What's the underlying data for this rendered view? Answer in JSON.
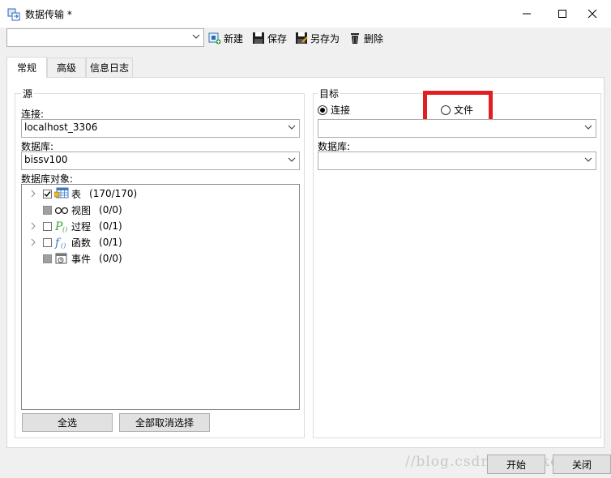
{
  "window": {
    "title": "数据传输 *"
  },
  "toolbar": {
    "profile_value": "",
    "new_label": "新建",
    "save_label": "保存",
    "save_as_label": "另存为",
    "delete_label": "删除"
  },
  "tabs": [
    {
      "label": "常规",
      "active": true
    },
    {
      "label": "高级",
      "active": false
    },
    {
      "label": "信息日志",
      "active": false
    }
  ],
  "source": {
    "group_label": "源",
    "connection_label": "连接:",
    "connection_value": "localhost_3306",
    "database_label": "数据库:",
    "database_value": "bissv100",
    "objects_label": "数据库对象:",
    "objects": [
      {
        "name": "表",
        "count": "(170/170)",
        "icon": "table-icon",
        "expandable": true,
        "check": "checked"
      },
      {
        "name": "视图",
        "count": "(0/0)",
        "icon": "view-icon",
        "expandable": false,
        "check": "disabled"
      },
      {
        "name": "过程",
        "count": "(0/1)",
        "icon": "procedure-icon",
        "expandable": true,
        "check": "unchecked"
      },
      {
        "name": "函数",
        "count": "(0/1)",
        "icon": "function-icon",
        "expandable": true,
        "check": "unchecked"
      },
      {
        "name": "事件",
        "count": "(0/0)",
        "icon": "event-icon",
        "expandable": false,
        "check": "disabled"
      }
    ],
    "select_all_label": "全选",
    "deselect_all_label": "全部取消选择"
  },
  "target": {
    "group_label": "目标",
    "radio_connection_label": "连接",
    "radio_file_label": "文件",
    "selected": "connection",
    "connection_value": "",
    "database_label": "数据库:",
    "database_value": ""
  },
  "footer": {
    "start_label": "开始",
    "close_label": "关闭"
  },
  "watermark": "//blog.csdn.net/fakename",
  "colors": {
    "highlight": "#e02020",
    "panel_bg": "#ffffff",
    "window_bg": "#f0f0f0"
  }
}
